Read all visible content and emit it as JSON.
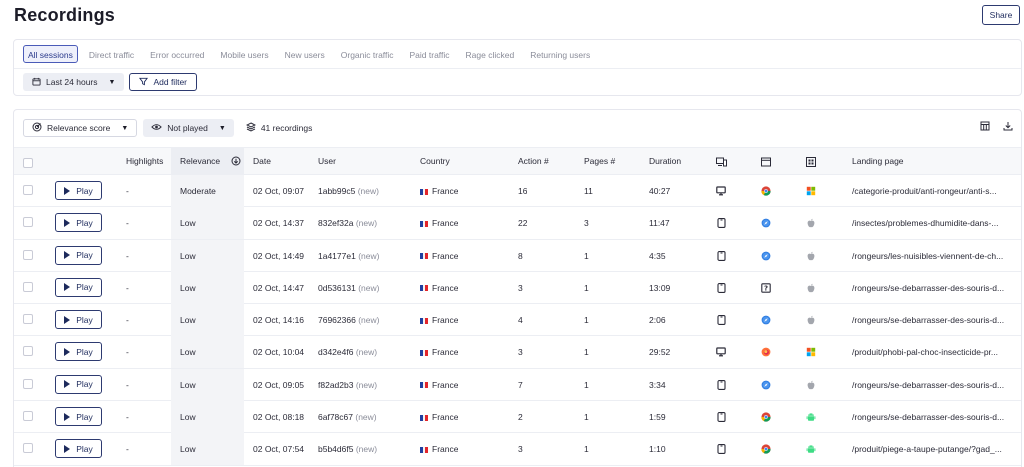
{
  "header": {
    "title": "Recordings",
    "share_label": "Share"
  },
  "segments": {
    "tabs": [
      {
        "label": "All sessions",
        "active": true
      },
      {
        "label": "Direct traffic",
        "active": false
      },
      {
        "label": "Error occurred",
        "active": false
      },
      {
        "label": "Mobile users",
        "active": false
      },
      {
        "label": "New users",
        "active": false
      },
      {
        "label": "Organic traffic",
        "active": false
      },
      {
        "label": "Paid traffic",
        "active": false
      },
      {
        "label": "Rage clicked",
        "active": false
      },
      {
        "label": "Returning users",
        "active": false
      }
    ],
    "date_filter": "Last 24 hours",
    "add_filter": "Add filter"
  },
  "toolbar": {
    "sort_label": "Relevance score",
    "played_filter": "Not played",
    "recordings_count": "41 recordings"
  },
  "table": {
    "columns": {
      "highlights": "Highlights",
      "relevance": "Relevance",
      "date": "Date",
      "user": "User",
      "country": "Country",
      "actions": "Action #",
      "pages": "Pages #",
      "duration": "Duration",
      "landing": "Landing page"
    },
    "play_label": "Play",
    "rows": [
      {
        "highlights": "-",
        "relevance": "Moderate",
        "date": "02 Oct, 09:07",
        "user": "1abb99c5",
        "new": "(new)",
        "country": "France",
        "actions": "16",
        "pages": "11",
        "duration": "40:27",
        "device": "desktop",
        "browser": "chrome",
        "os": "windows",
        "landing": "/categorie-produit/anti-rongeur/anti-s..."
      },
      {
        "highlights": "-",
        "relevance": "Low",
        "date": "02 Oct, 14:37",
        "user": "832ef32a",
        "new": "(new)",
        "country": "France",
        "actions": "22",
        "pages": "3",
        "duration": "11:47",
        "device": "mobile",
        "browser": "safari",
        "os": "apple",
        "landing": "/insectes/problemes-dhumidite-dans-..."
      },
      {
        "highlights": "-",
        "relevance": "Low",
        "date": "02 Oct, 14:49",
        "user": "1a4177e1",
        "new": "(new)",
        "country": "France",
        "actions": "8",
        "pages": "1",
        "duration": "4:35",
        "device": "mobile",
        "browser": "safari",
        "os": "apple",
        "landing": "/rongeurs/les-nuisibles-viennent-de-ch..."
      },
      {
        "highlights": "-",
        "relevance": "Low",
        "date": "02 Oct, 14:47",
        "user": "0d536131",
        "new": "(new)",
        "country": "France",
        "actions": "3",
        "pages": "1",
        "duration": "13:09",
        "device": "mobile",
        "browser": "unknown",
        "os": "apple",
        "landing": "/rongeurs/se-debarrasser-des-souris-d..."
      },
      {
        "highlights": "-",
        "relevance": "Low",
        "date": "02 Oct, 14:16",
        "user": "76962366",
        "new": "(new)",
        "country": "France",
        "actions": "4",
        "pages": "1",
        "duration": "2:06",
        "device": "mobile",
        "browser": "safari",
        "os": "apple",
        "landing": "/rongeurs/se-debarrasser-des-souris-d..."
      },
      {
        "highlights": "-",
        "relevance": "Low",
        "date": "02 Oct, 10:04",
        "user": "d342e4f6",
        "new": "(new)",
        "country": "France",
        "actions": "3",
        "pages": "1",
        "duration": "29:52",
        "device": "desktop",
        "browser": "firefox",
        "os": "windows",
        "landing": "/produit/phobi-pal-choc-insecticide-pr..."
      },
      {
        "highlights": "-",
        "relevance": "Low",
        "date": "02 Oct, 09:05",
        "user": "f82ad2b3",
        "new": "(new)",
        "country": "France",
        "actions": "7",
        "pages": "1",
        "duration": "3:34",
        "device": "mobile",
        "browser": "safari",
        "os": "apple",
        "landing": "/rongeurs/se-debarrasser-des-souris-d..."
      },
      {
        "highlights": "-",
        "relevance": "Low",
        "date": "02 Oct, 08:18",
        "user": "6af78c67",
        "new": "(new)",
        "country": "France",
        "actions": "2",
        "pages": "1",
        "duration": "1:59",
        "device": "mobile",
        "browser": "chrome",
        "os": "android",
        "landing": "/rongeurs/se-debarrasser-des-souris-d..."
      },
      {
        "highlights": "-",
        "relevance": "Low",
        "date": "02 Oct, 07:54",
        "user": "b5b4d6f5",
        "new": "(new)",
        "country": "France",
        "actions": "3",
        "pages": "1",
        "duration": "1:10",
        "device": "mobile",
        "browser": "chrome",
        "os": "android",
        "landing": "/produit/piege-a-taupe-putange/?gad_..."
      }
    ]
  }
}
